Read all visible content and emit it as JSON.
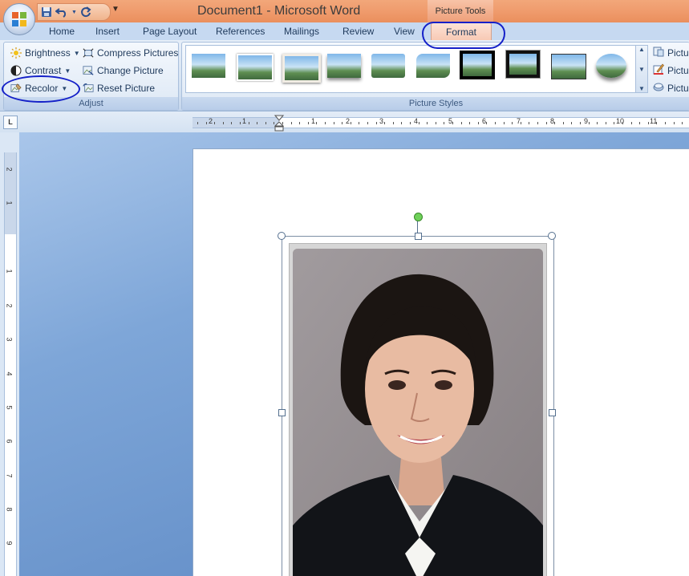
{
  "window": {
    "title": "Document1 - Microsoft Word",
    "contextual_tab_group": "Picture Tools"
  },
  "tabs": [
    {
      "label": "Home"
    },
    {
      "label": "Insert"
    },
    {
      "label": "Page Layout"
    },
    {
      "label": "References"
    },
    {
      "label": "Mailings"
    },
    {
      "label": "Review"
    },
    {
      "label": "View"
    },
    {
      "label": "Format",
      "active": true
    }
  ],
  "ribbon": {
    "adjust": {
      "label": "Adjust",
      "brightness": "Brightness",
      "contrast": "Contrast",
      "recolor": "Recolor",
      "compress": "Compress Pictures",
      "change": "Change Picture",
      "reset": "Reset Picture"
    },
    "picture_styles": {
      "label": "Picture Styles",
      "thumb_count": 10
    },
    "right_partial": [
      "Pictur",
      "Pictur",
      "Pictur"
    ]
  },
  "ruler": {
    "tab_selector": "L",
    "h_labels": [
      "2",
      "1",
      "1",
      "2",
      "3",
      "4",
      "5",
      "6",
      "7",
      "8",
      "9",
      "10",
      "11"
    ],
    "v_labels": [
      "2",
      "1",
      "1",
      "2",
      "3",
      "4",
      "5",
      "6",
      "7",
      "8",
      "9"
    ]
  },
  "annotations": {
    "ink_color": "#1420c8",
    "circled": [
      "Format tab",
      "Recolor"
    ]
  },
  "colors": {
    "title_bar": "#ef9a6b",
    "ribbon": "#d3e1f1",
    "workspace": "#5a86c2",
    "selection_handle": "#6fd15a"
  }
}
